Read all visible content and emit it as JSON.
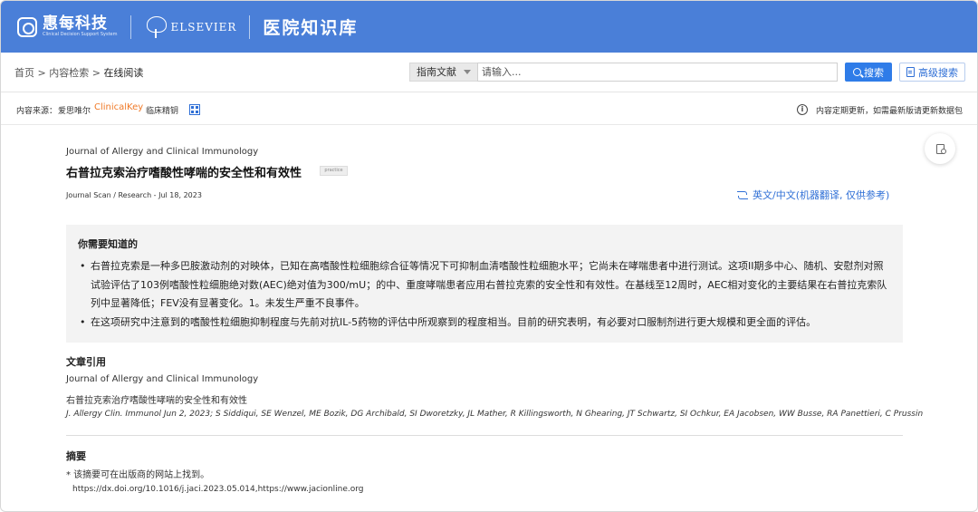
{
  "header": {
    "brand_name": "惠每科技",
    "brand_sub": "Clinical Decision Support System",
    "partner": "ELSEVIER",
    "kb_title": "医院知识库"
  },
  "nav": {
    "breadcrumb": [
      "首页",
      "内容检索",
      "在线阅读"
    ],
    "breadcrumb_sep": ">",
    "search_scope": "指南文献",
    "search_placeholder": "请输入...",
    "search_button": "搜索",
    "advanced_button": "高级搜索"
  },
  "source": {
    "label": "内容来源：",
    "publisher": "爱思唯尔",
    "clinicalkey": "ClinicalKey",
    "clinicalkey_suffix": "临床精钥",
    "update_note": "内容定期更新，如需最新版请更新数据包"
  },
  "article": {
    "journal": "Journal of Allergy and Clinical Immunology",
    "title": "右普拉克索治疗嗜酸性哮喘的安全性和有效性",
    "badge": "practice",
    "meta": "Journal Scan / Research - Jul 18, 2023",
    "translate_label": "英文/中文(机器翻译, 仅供参考)"
  },
  "know": {
    "title": "你需要知道的",
    "bullets": [
      "右普拉克索是一种多巴胺激动剂的对映体，已知在高嗜酸性粒细胞综合征等情况下可抑制血清嗜酸性粒细胞水平；它尚未在哮喘患者中进行测试。这项II期多中心、随机、安慰剂对照试验评估了103例嗜酸性粒细胞绝对数(AEC)绝对值为300/mU；的中、重度哮喘患者应用右普拉克索的安全性和有效性。在基线至12周时，AEC相对变化的主要结果在右普拉克索队列中显著降低；FEV没有显著变化。1。未发生严重不良事件。",
      "在这项研究中注意到的嗜酸性粒细胞抑制程度与先前对抗IL-5药物的评估中所观察到的程度相当。目前的研究表明，有必要对口服制剂进行更大规模和更全面的评估。"
    ]
  },
  "citation": {
    "title": "文章引用",
    "journal": "Journal of Allergy and Clinical Immunology",
    "article": "右普拉克索治疗嗜酸性哮喘的安全性和有效性",
    "reference": "J. Allergy Clin. Immunol Jun 2, 2023; S Siddiqui, SE Wenzel, ME Bozik, DG Archibald, SI Dworetzky, JL Mather, R Killingsworth, N Ghearing, JT Schwartz, SI Ochkur, EA Jacobsen, WW Busse, RA Panettieri, C Prussin"
  },
  "abstract": {
    "title": "摘要",
    "note": "* 该摘要可在出版商的网站上找到。",
    "link": "https://dx.doi.org/10.1016/j.jaci.2023.05.014,https://www.jacionline.org"
  },
  "colors": {
    "header_bg": "#4a7fd8",
    "accent": "#2f7ce8",
    "clinicalkey_orange": "#f07a28"
  }
}
